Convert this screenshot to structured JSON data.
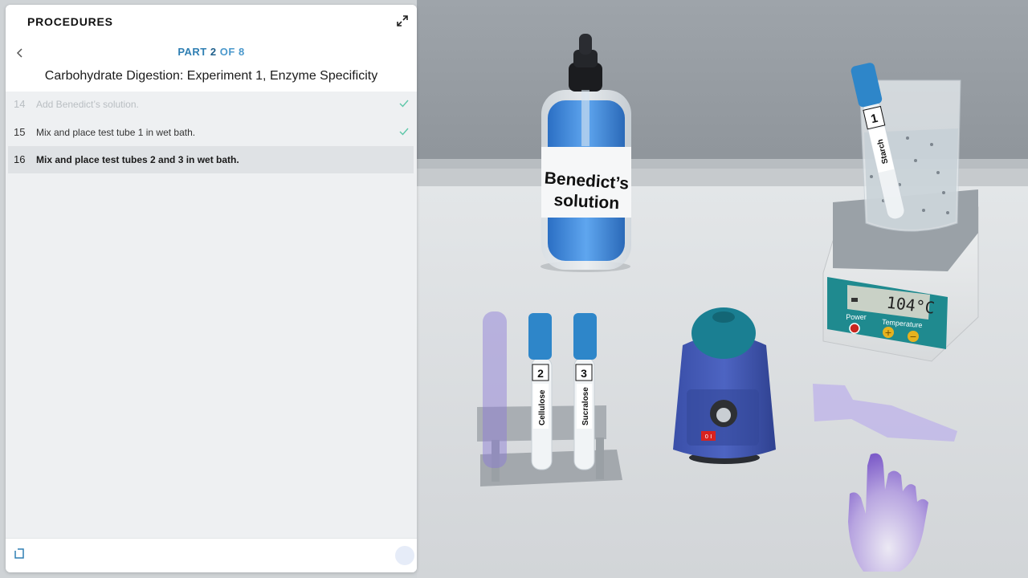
{
  "panel": {
    "title": "PROCEDURES",
    "part": {
      "prefix": "PART",
      "current": "2",
      "of": "OF",
      "total": "8"
    },
    "experiment_title": "Carbohydrate Digestion: Experiment 1, Enzyme Specificity",
    "steps": [
      {
        "number": "14",
        "text": "Add Benedict’s solution.",
        "status": "done"
      },
      {
        "number": "15",
        "text": "Mix and place test tube 1 in wet bath.",
        "status": "done"
      },
      {
        "number": "16",
        "text": "Mix and place test tubes 2 and 3 in wet bath.",
        "status": "current"
      }
    ]
  },
  "scene": {
    "bottle_label_line1": "Benedict’s",
    "bottle_label_line2": "solution",
    "tube1": {
      "number": "1",
      "label": "Starch"
    },
    "tube2": {
      "number": "2",
      "label": "Cellulose"
    },
    "tube3": {
      "number": "3",
      "label": "Sucralose"
    },
    "hotplate": {
      "temperature_display": "104°C",
      "power_label": "Power",
      "temperature_label": "Temperature",
      "plus_symbol": "+",
      "minus_symbol": "−"
    },
    "vortex_switch": "0 I"
  },
  "colors": {
    "accent": "#2f7fb3",
    "check": "#5cc6a8",
    "tube_cap": "#2e86c9",
    "hotplate_panel": "#1f8a8f"
  }
}
